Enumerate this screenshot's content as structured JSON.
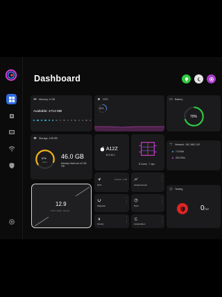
{
  "header": {
    "title": "Dashboard"
  },
  "colors": {
    "accent": "#2f6de0",
    "green": "#2ecc40",
    "yellow": "#f2b418",
    "red": "#e02424",
    "wifi_ok": "#2fb8e6",
    "pink": "#d63fd6"
  },
  "header_actions": [
    {
      "icon": "lightbulb-icon",
      "color": "#2ecc40"
    },
    {
      "icon": "moon-icon",
      "color": "#e6e6e6"
    },
    {
      "icon": "record-icon",
      "color": "#a93cc9"
    }
  ],
  "sidebar": {
    "items": [
      {
        "icon": "dashboard-grid-icon",
        "active": true
      },
      {
        "icon": "cpu-icon",
        "active": false
      },
      {
        "icon": "display-icon",
        "active": false
      },
      {
        "icon": "wifi-icon",
        "active": false
      },
      {
        "icon": "shield-icon",
        "active": false
      }
    ],
    "settings_icon": "gear-icon"
  },
  "memory": {
    "title": "Memory: 6 GB",
    "available_label": "Available: 4713 MB"
  },
  "cpu": {
    "title": "CPU",
    "percent_label": "31%",
    "percent": 31
  },
  "battery": {
    "title": "Battery",
    "percent_label": "70%",
    "percent": 70
  },
  "storage": {
    "title": "Storage: 128 GB",
    "ring_value": "67%",
    "ring_caption": "Used",
    "used": "46.0 GB",
    "detail": "Already Used out of 128 GB",
    "percent": 36
  },
  "chip": {
    "name": "A12Z",
    "brand": "BIONIC"
  },
  "cores": {
    "label": "8 Cores · 7 cpu"
  },
  "network": {
    "title": "Network: 192.168.1.52",
    "up": "7.6 KB/s",
    "down": "45.6 KB/s"
  },
  "display": {
    "value": "12.9",
    "sub": "2732 x 2048 · 264 ppi"
  },
  "sensors": [
    {
      "icon": "gps-icon",
      "label": "GPS",
      "value": "Position: 1 KM"
    },
    {
      "icon": "motion-icon",
      "label": "Accelerometer",
      "value": ""
    },
    {
      "icon": "magnet-icon",
      "label": "Magnetic",
      "value": ""
    },
    {
      "icon": "pressure-icon",
      "label": "Pitch",
      "value": ""
    },
    {
      "icon": "gravity-icon",
      "label": "Gravity",
      "value": ""
    },
    {
      "icon": "rotation-icon",
      "label": "Acceleration",
      "value": ""
    }
  ],
  "testing": {
    "title": "Testing",
    "score": "0",
    "total": "/12"
  }
}
